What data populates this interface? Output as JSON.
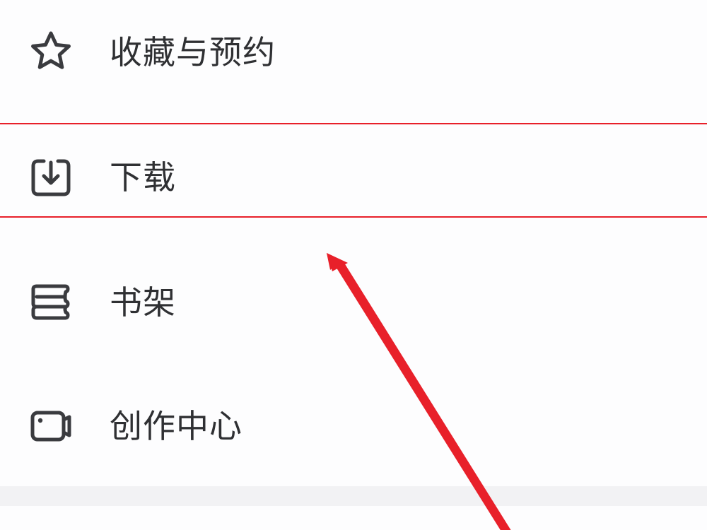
{
  "menu": {
    "items": [
      {
        "icon": "star-icon",
        "label": "收藏与预约"
      },
      {
        "icon": "download-icon",
        "label": "下载"
      },
      {
        "icon": "bookshelf-icon",
        "label": "书架"
      },
      {
        "icon": "creator-center-icon",
        "label": "创作中心"
      }
    ]
  },
  "annotation": {
    "highlight_target": "下载",
    "color": "#e8202a"
  },
  "colors": {
    "text": "#2f3033",
    "icon_stroke": "#3a3b3f",
    "background": "#fdfdfe",
    "divider_band": "#f2f2f4"
  }
}
